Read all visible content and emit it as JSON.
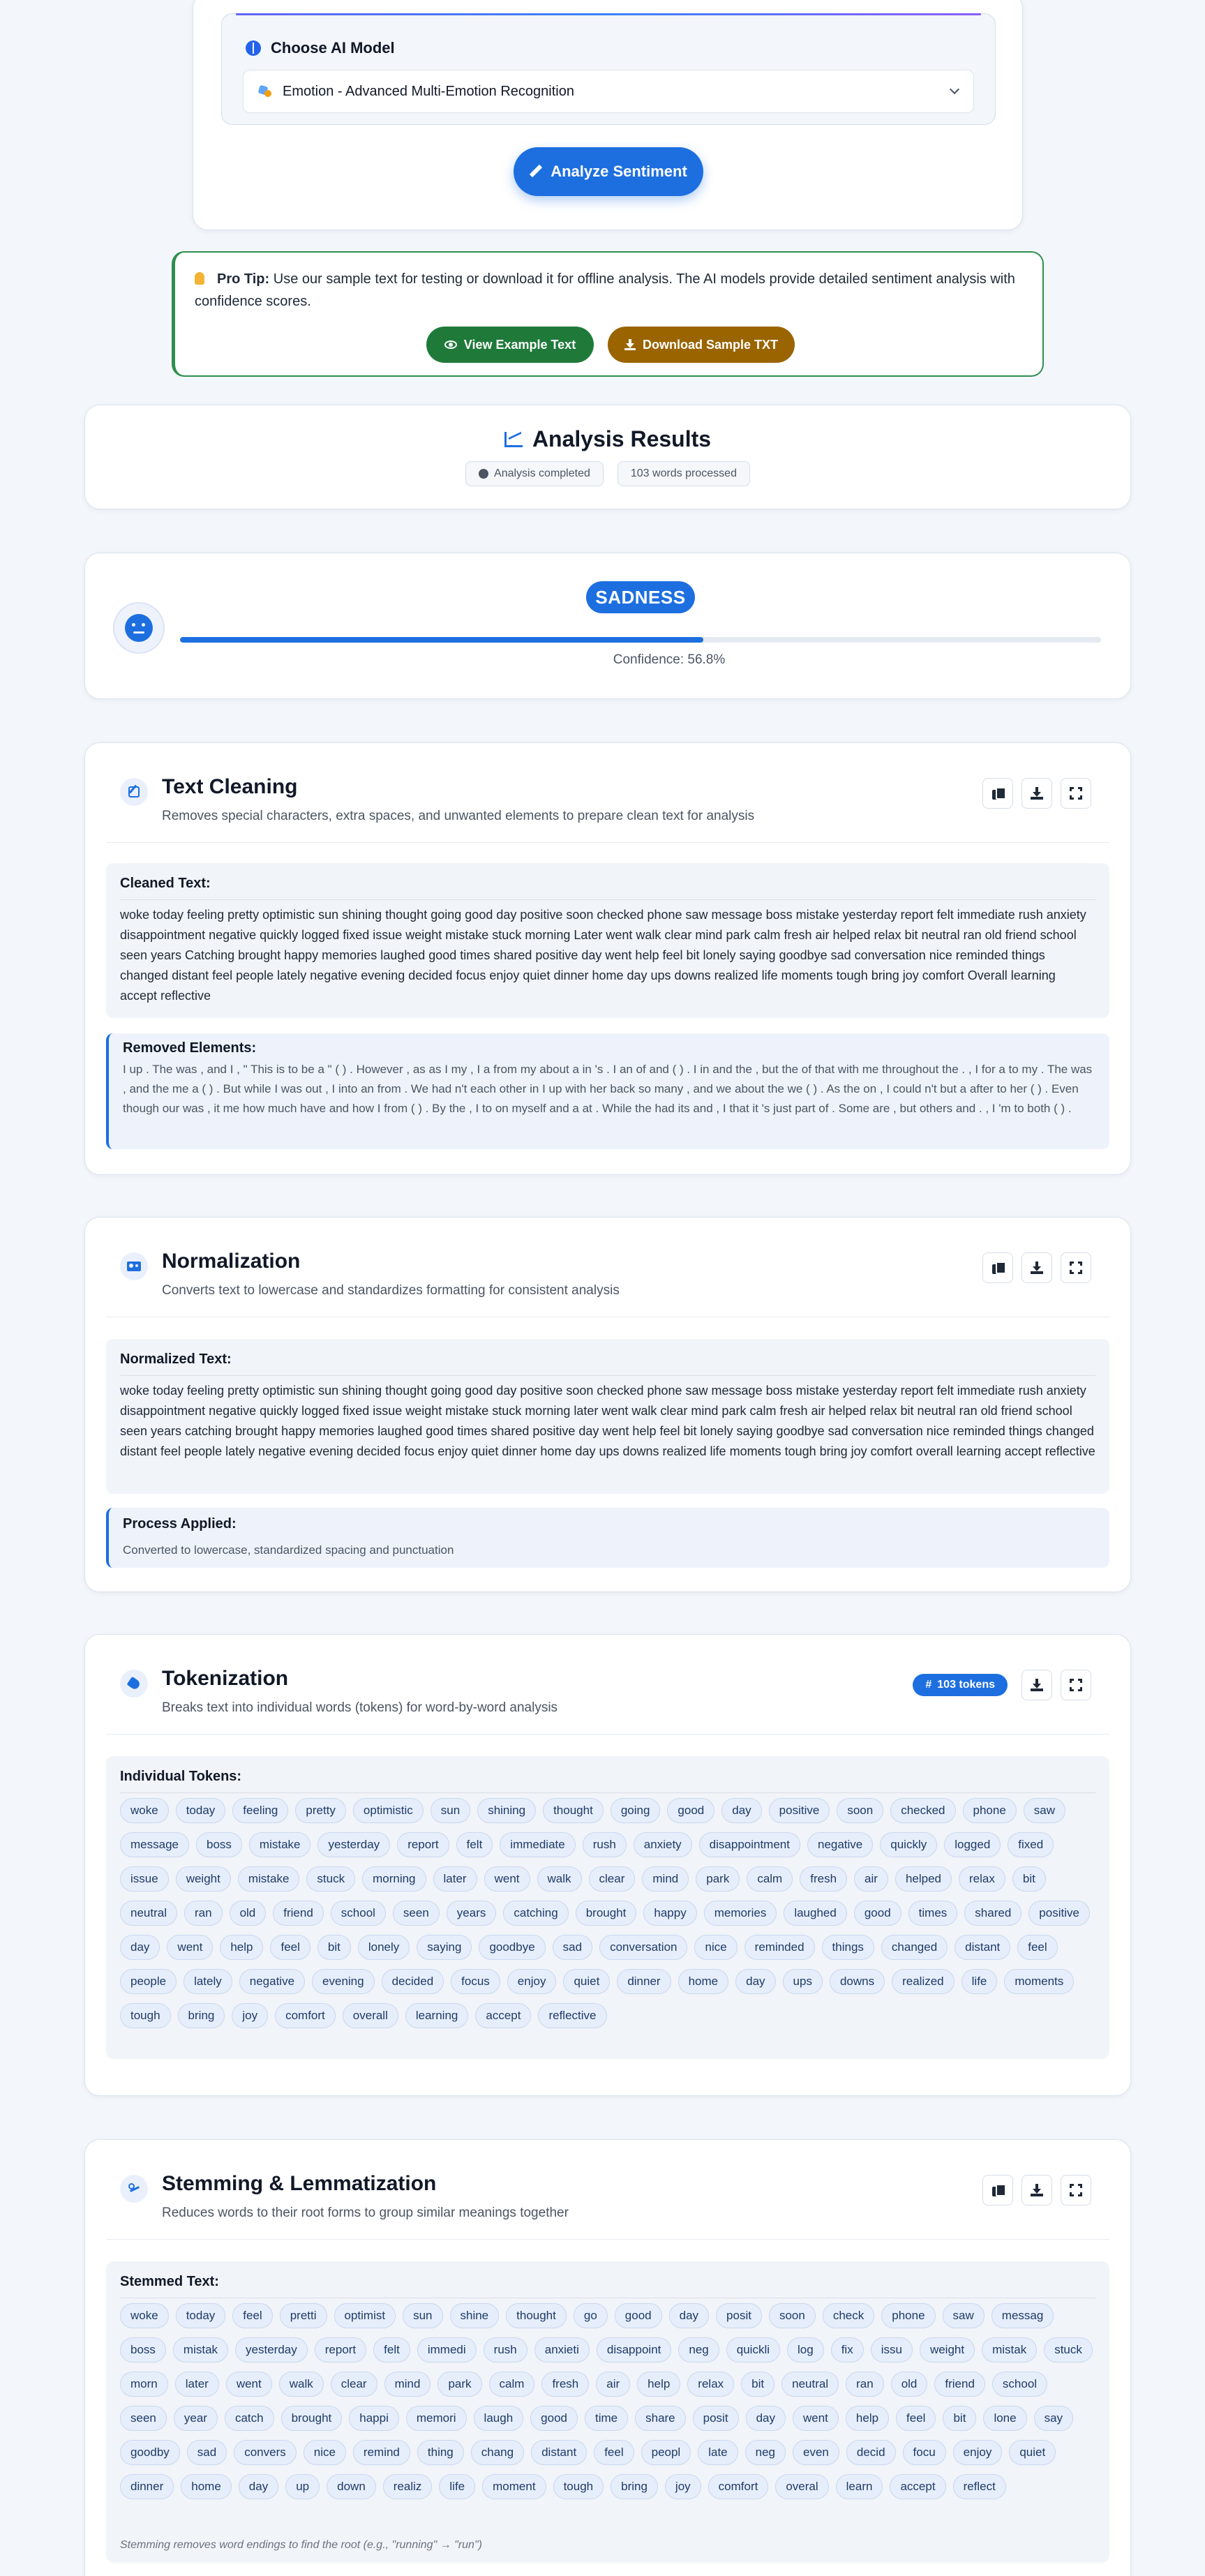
{
  "model": {
    "label": "Choose AI Model",
    "selected": "Emotion - Advanced Multi-Emotion Recognition",
    "analyze_label": "Analyze Sentiment"
  },
  "tip": {
    "lead": "Pro Tip:",
    "text": " Use our sample text for testing or download it for offline analysis. The AI models provide detailed sentiment analysis with confidence scores.",
    "example_label": "View Example Text",
    "download_label": "Download Sample TXT"
  },
  "results": {
    "title": "Analysis Results",
    "status": "Analysis completed",
    "words": "103 words processed"
  },
  "emotion": {
    "label": "SADNESS",
    "confidence_text": "Confidence: 56.8%",
    "confidence": 0.568
  },
  "cleaning": {
    "title": "Text Cleaning",
    "subtitle": "Removes special characters, extra spaces, and unwanted elements to prepare clean text for analysis",
    "cleaned_label": "Cleaned Text:",
    "cleaned_text": "woke today feeling pretty optimistic sun shining thought going good day positive soon checked phone saw message boss mistake yesterday report felt immediate rush anxiety disappointment negative quickly logged fixed issue weight mistake stuck morning Later went walk clear mind park calm fresh air helped relax bit neutral ran old friend school seen years Catching brought happy memories laughed good times shared positive day went help feel bit lonely saying goodbye sad conversation nice reminded things changed distant feel people lately negative evening decided focus enjoy quiet dinner home day ups downs realized life moments tough bring joy comfort Overall learning accept reflective",
    "removed_label": "Removed Elements:",
    "removed_text": "I up . The was , and I , \" This is to be a \" ( ) . However , as as I my , I a from my about a in 's . I an of and ( ) . I in and the , but the of that with me throughout the . , I for a to my . The was , and the me a ( ) . But while I was out , I into an from . We had n't each other in I up with her back so many , and we about the we ( ) . As the on , I could n't but a after to her ( ) . Even though our was , it me how much have and how I from ( ) . By the , I to on myself and a at . While the had its and , I that it 's just part of . Some are , but others and . , I 'm to both ( ) ."
  },
  "normalization": {
    "title": "Normalization",
    "subtitle": "Converts text to lowercase and standardizes formatting for consistent analysis",
    "normalized_label": "Normalized Text:",
    "normalized_text": "woke today feeling pretty optimistic sun shining thought going good day positive soon checked phone saw message boss mistake yesterday report felt immediate rush anxiety disappointment negative quickly logged fixed issue weight mistake stuck morning later went walk clear mind park calm fresh air helped relax bit neutral ran old friend school seen years catching brought happy memories laughed good times shared positive day went help feel bit lonely saying goodbye sad conversation nice reminded things changed distant feel people lately negative evening decided focus enjoy quiet dinner home day ups downs realized life moments tough bring joy comfort overall learning accept reflective",
    "process_label": "Process Applied:",
    "process_text": "Converted to lowercase, standardized spacing and punctuation"
  },
  "tokenization": {
    "title": "Tokenization",
    "subtitle": "Breaks text into individual words (tokens) for word-by-word analysis",
    "badge": "103 tokens",
    "tokens_label": "Individual Tokens:",
    "tokens": [
      "woke",
      "today",
      "feeling",
      "pretty",
      "optimistic",
      "sun",
      "shining",
      "thought",
      "going",
      "good",
      "day",
      "positive",
      "soon",
      "checked",
      "phone",
      "saw",
      "message",
      "boss",
      "mistake",
      "yesterday",
      "report",
      "felt",
      "immediate",
      "rush",
      "anxiety",
      "disappointment",
      "negative",
      "quickly",
      "logged",
      "fixed",
      "issue",
      "weight",
      "mistake",
      "stuck",
      "morning",
      "later",
      "went",
      "walk",
      "clear",
      "mind",
      "park",
      "calm",
      "fresh",
      "air",
      "helped",
      "relax",
      "bit",
      "neutral",
      "ran",
      "old",
      "friend",
      "school",
      "seen",
      "years",
      "catching",
      "brought",
      "happy",
      "memories",
      "laughed",
      "good",
      "times",
      "shared",
      "positive",
      "day",
      "went",
      "help",
      "feel",
      "bit",
      "lonely",
      "saying",
      "goodbye",
      "sad",
      "conversation",
      "nice",
      "reminded",
      "things",
      "changed",
      "distant",
      "feel",
      "people",
      "lately",
      "negative",
      "evening",
      "decided",
      "focus",
      "enjoy",
      "quiet",
      "dinner",
      "home",
      "day",
      "ups",
      "downs",
      "realized",
      "life",
      "moments",
      "tough",
      "bring",
      "joy",
      "comfort",
      "overall",
      "learning",
      "accept",
      "reflective"
    ]
  },
  "stemming": {
    "title": "Stemming & Lemmatization",
    "subtitle": "Reduces words to their root forms to group similar meanings together",
    "stemmed_label": "Stemmed Text:",
    "stems": [
      "woke",
      "today",
      "feel",
      "pretti",
      "optimist",
      "sun",
      "shine",
      "thought",
      "go",
      "good",
      "day",
      "posit",
      "soon",
      "check",
      "phone",
      "saw",
      "messag",
      "boss",
      "mistak",
      "yesterday",
      "report",
      "felt",
      "immedi",
      "rush",
      "anxieti",
      "disappoint",
      "neg",
      "quickli",
      "log",
      "fix",
      "issu",
      "weight",
      "mistak",
      "stuck",
      "morn",
      "later",
      "went",
      "walk",
      "clear",
      "mind",
      "park",
      "calm",
      "fresh",
      "air",
      "help",
      "relax",
      "bit",
      "neutral",
      "ran",
      "old",
      "friend",
      "school",
      "seen",
      "year",
      "catch",
      "brought",
      "happi",
      "memori",
      "laugh",
      "good",
      "time",
      "share",
      "posit",
      "day",
      "went",
      "help",
      "feel",
      "bit",
      "lone",
      "say",
      "goodby",
      "sad",
      "convers",
      "nice",
      "remind",
      "thing",
      "chang",
      "distant",
      "feel",
      "peopl",
      "late",
      "neg",
      "even",
      "decid",
      "focu",
      "enjoy",
      "quiet",
      "dinner",
      "home",
      "day",
      "up",
      "down",
      "realiz",
      "life",
      "moment",
      "tough",
      "bring",
      "joy",
      "comfort",
      "overal",
      "learn",
      "accept",
      "reflect"
    ],
    "note": "Stemming removes word endings to find the root (e.g., \"running\" → \"run\")"
  }
}
